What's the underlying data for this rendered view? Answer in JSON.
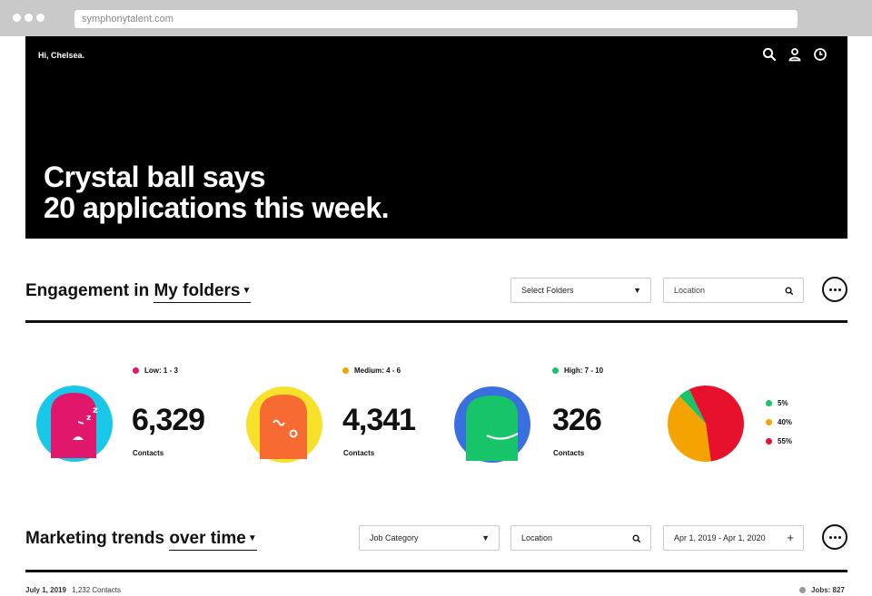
{
  "browser": {
    "url": "symphonytalent.com"
  },
  "hero": {
    "greeting": "Hi, Chelsea.",
    "headline_line1": "Crystal ball says",
    "headline_line2": "20 applications this week."
  },
  "engagement": {
    "title_prefix": "Engagement in",
    "title_link": "My folders",
    "select_folders": "Select Folders",
    "location_placeholder": "Location",
    "metrics": [
      {
        "level": "Low: 1 - 3",
        "value": "6,329",
        "label": "Contacts",
        "color": "#e0176b"
      },
      {
        "level": "Medium: 4 - 6",
        "value": "4,341",
        "label": "Contacts",
        "color": "#f4a300"
      },
      {
        "level": "High: 7 - 10",
        "value": "326",
        "label": "Contacts",
        "color": "#18c46a"
      }
    ],
    "pie": [
      {
        "label": "5%",
        "value": 5,
        "color": "#18c46a"
      },
      {
        "label": "40%",
        "value": 40,
        "color": "#f4a300"
      },
      {
        "label": "55%",
        "value": 55,
        "color": "#e8112d"
      }
    ]
  },
  "trends": {
    "title_prefix": "Marketing trends",
    "title_link": "over time",
    "job_category": "Job Category",
    "location_placeholder": "Location",
    "date_range": "Apr 1, 2019 - Apr 1, 2020",
    "footer_date": "July 1, 2019",
    "footer_contacts": "1,232 Contacts",
    "footer_jobs": "Jobs: 827"
  }
}
